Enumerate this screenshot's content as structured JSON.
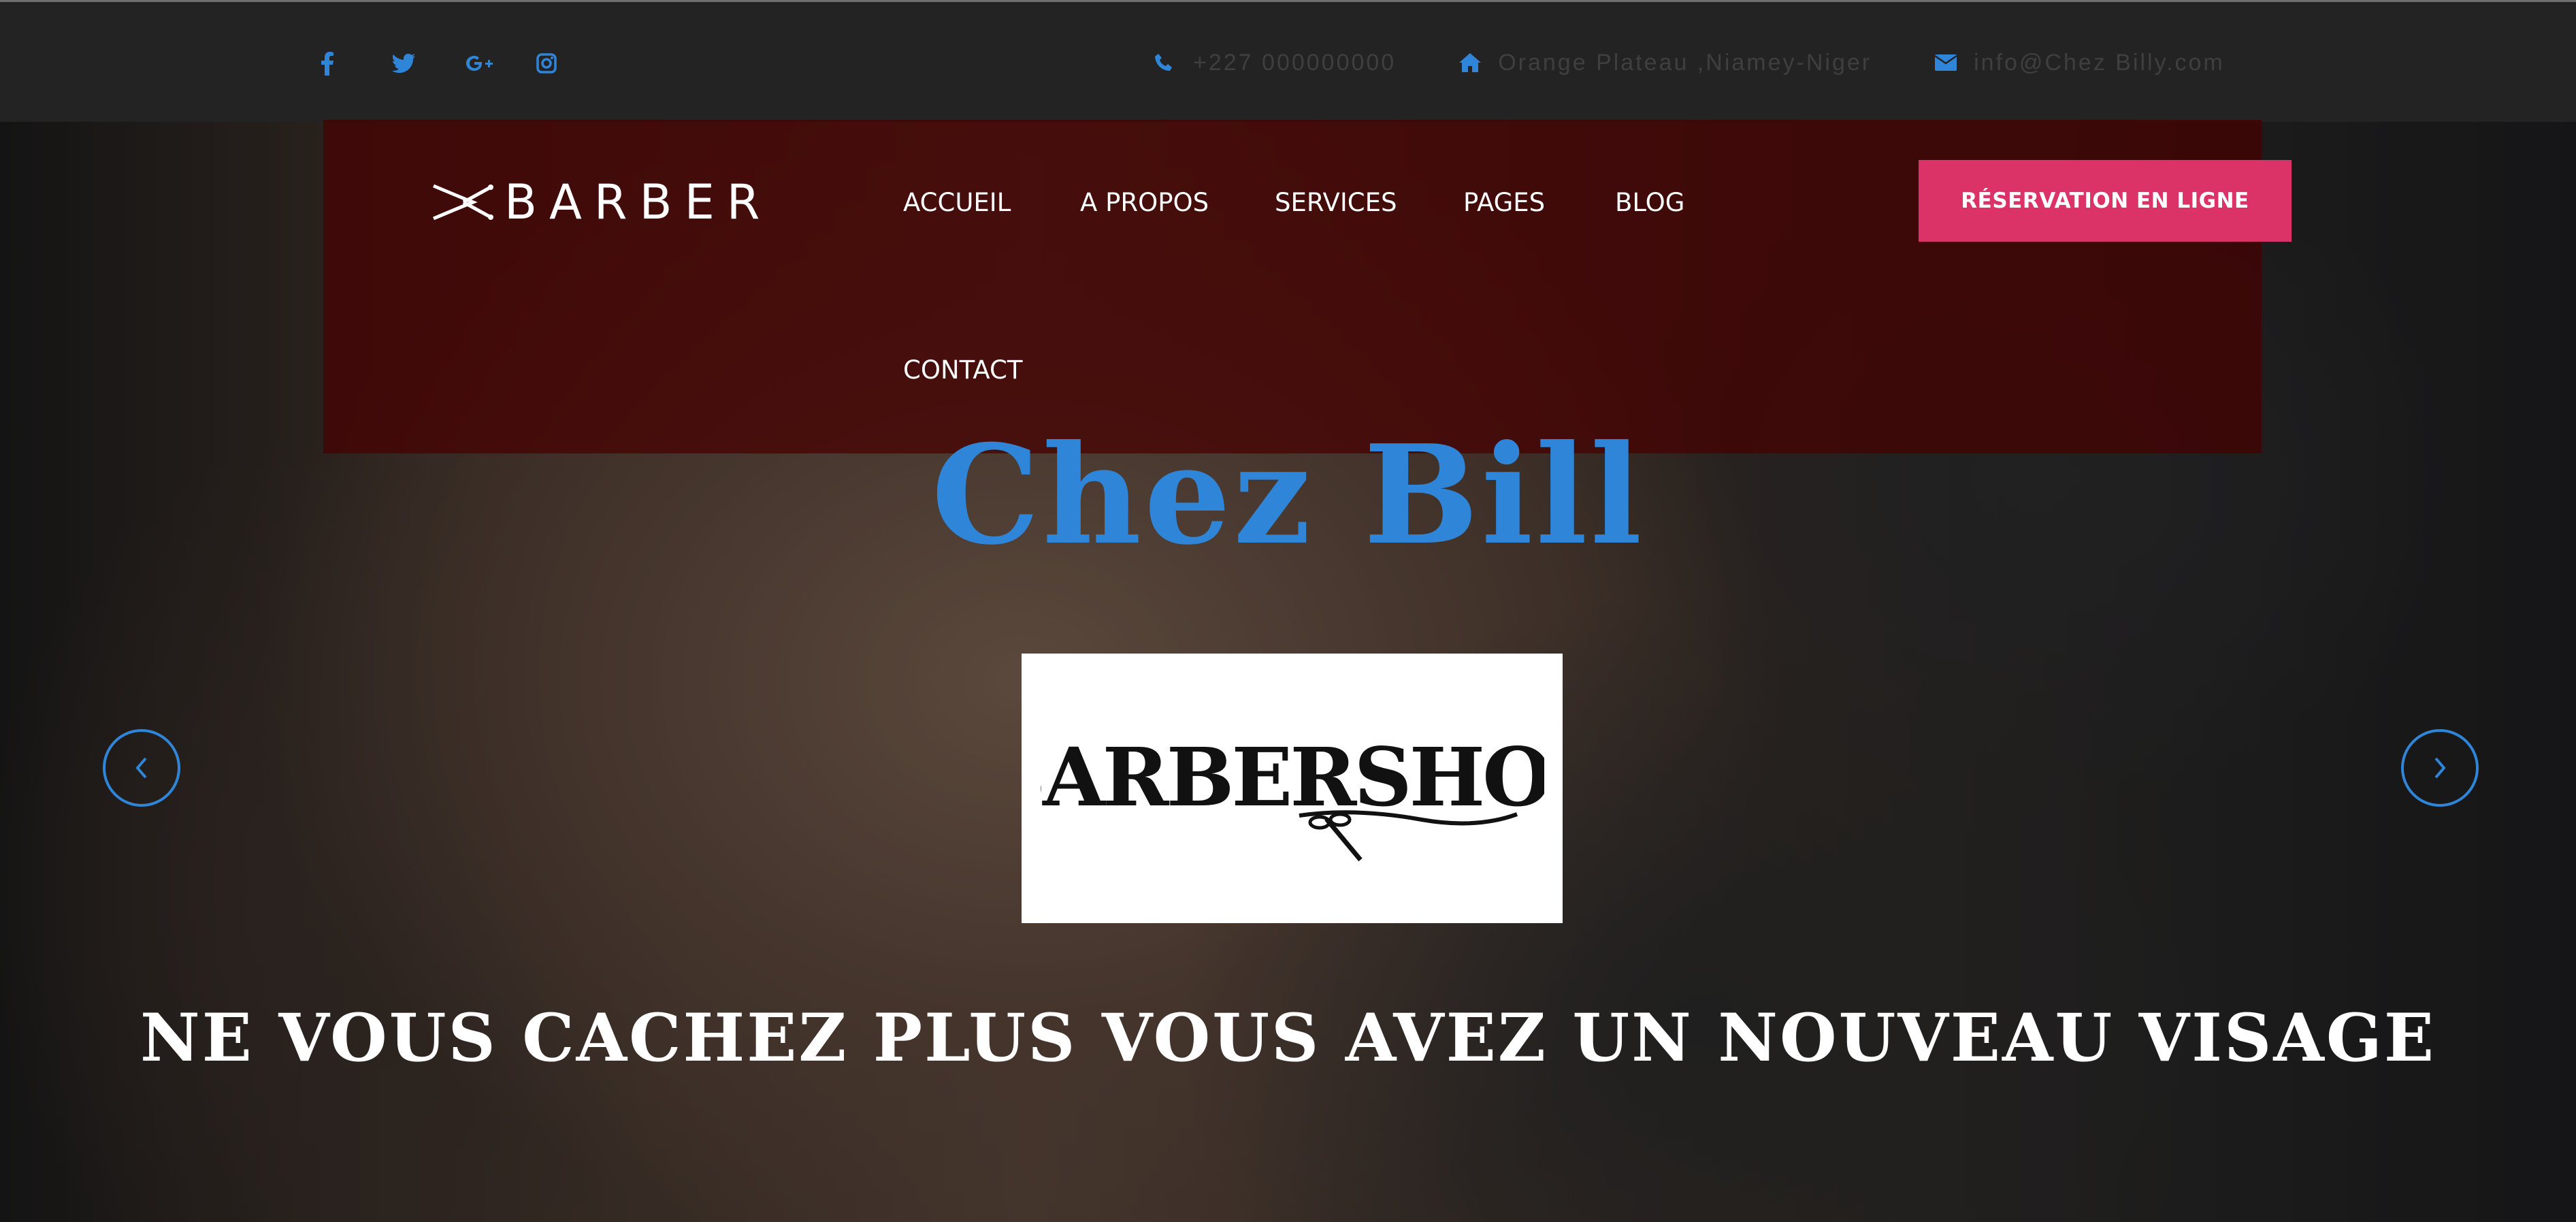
{
  "topbar": {
    "social": [
      {
        "name": "facebook",
        "glyph": "f"
      },
      {
        "name": "twitter",
        "glyph": "t"
      },
      {
        "name": "google-plus",
        "glyph": "G+"
      },
      {
        "name": "instagram",
        "glyph": "ig"
      }
    ],
    "phone": "+227 000000000",
    "address": "Orange Plateau ,Niamey-Niger",
    "email": "info@Chez Billy.com"
  },
  "nav": {
    "logo_text": "BARBER",
    "items": [
      "ACCUEIL",
      "A PROPOS",
      "SERVICES",
      "PAGES",
      "BLOG",
      "CONTACT"
    ],
    "cta_label": "RÉSERVATION EN LIGNE"
  },
  "hero": {
    "title": "Chez Bill",
    "brand_image_text": "BARBERSHOP",
    "tagline": "NE VOUS CACHEZ PLUS VOUS AVEZ UN NOUVEAU VISAGE"
  },
  "colors": {
    "accent_blue": "#2f86d9",
    "cta_pink": "#db3368",
    "nav_overlay": "rgba(70,0,0,0.72)"
  }
}
